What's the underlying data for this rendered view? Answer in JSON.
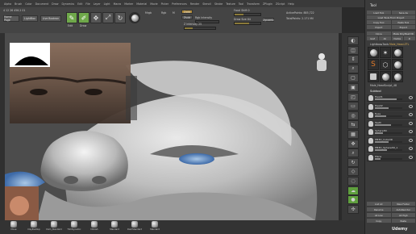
{
  "menu": [
    "Alpha",
    "Brush",
    "Color",
    "Document",
    "Draw",
    "Dynamics",
    "Edit",
    "File",
    "Layer",
    "Light",
    "Macro",
    "Marker",
    "Material",
    "Movie",
    "Picker",
    "Preferences",
    "Render",
    "Stencil",
    "Stroke",
    "Texture",
    "Tool",
    "Transform",
    "ZPlugin",
    "ZScript",
    "Help"
  ],
  "toolbar": {
    "home_page": "Home Page",
    "lightbox": "LightBox",
    "live_boolean": "Live Boolean",
    "edit": "Edit",
    "draw": "Draw",
    "move": "Move",
    "scale": "Scale",
    "rotate": "Rotate",
    "mrgb": "Mrgb",
    "rgb": "Rgb",
    "m": "M",
    "zadd": "Zadd",
    "zsub": "Zsub",
    "focal_shift_label": "Focal Shift 0",
    "draw_size_label": "Draw Size 64",
    "z_intensity_label": "Z Intensity 25",
    "rgb_intensity_label": "Rgb Intensity",
    "dynamic": "Dynamic",
    "active_points": "ActivePoints: 885,722",
    "total_points": "TotalPoints: 2.171 Mil",
    "status_line": "4 12 26 456.2 01",
    "draw_size_fill": 0.55,
    "focal_fill": 0.35,
    "zint_fill": 0.25
  },
  "right_shelf": [
    "BPR",
    "SPix 3",
    "Scroll",
    "Zoom",
    "Actual",
    "AAHalf",
    "Persp",
    "Floor",
    "Local",
    "L.Sym",
    "Frame",
    "Move",
    "Zoom3D",
    "Rotate",
    "PolyF",
    "Transp",
    "Ghost",
    "Solo",
    "Xpose"
  ],
  "tool_panel": {
    "title": "Tool",
    "load_tool": "Load Tool",
    "save_as": "Save As",
    "load_from_project": "Load Tools From Project",
    "copy_tool": "Copy Tool",
    "paste_tool": "Paste Tool",
    "import": "Import",
    "export": "Export",
    "clone": "Clone",
    "make_polymesh": "Make PolyMesh3D",
    "goz": "GoZ",
    "all": "All",
    "visible": "Visible",
    "r": "R",
    "lightbox_tools": "Lightbox▸Tools",
    "current_tool": "Male_Head.ZTL",
    "tool_name": "Male_HeadSculpt_48",
    "subtool": "Subtool",
    "subtools": [
      {
        "name": "Head1",
        "fill": 0.8
      },
      {
        "name": "Head2",
        "fill": 0.5
      },
      {
        "name": "Eyes",
        "fill": 0.4
      },
      {
        "name": "Teeth",
        "fill": 0.6
      },
      {
        "name": "Sphere3D",
        "fill": 0.3
      },
      {
        "name": "PM3D_Cube3D",
        "fill": 0.5
      },
      {
        "name": "PM3D_Sphere3D_1",
        "fill": 0.45
      },
      {
        "name": "Plane",
        "fill": 0.2
      }
    ],
    "list_all": "List All",
    "new_folder": "New Folder",
    "rename": "Rename",
    "auto_reorder": "AutoReorder",
    "all_low": "All Low",
    "all_high": "All High",
    "copy": "Copy",
    "paste": "Paste"
  },
  "bottom_tools": [
    "Move",
    "ClayBuildup",
    "Dam_Standard",
    "TrimDynamic",
    "hPolish",
    "Standard",
    "DamStandard",
    "Standard"
  ],
  "watermark": "Udemy"
}
